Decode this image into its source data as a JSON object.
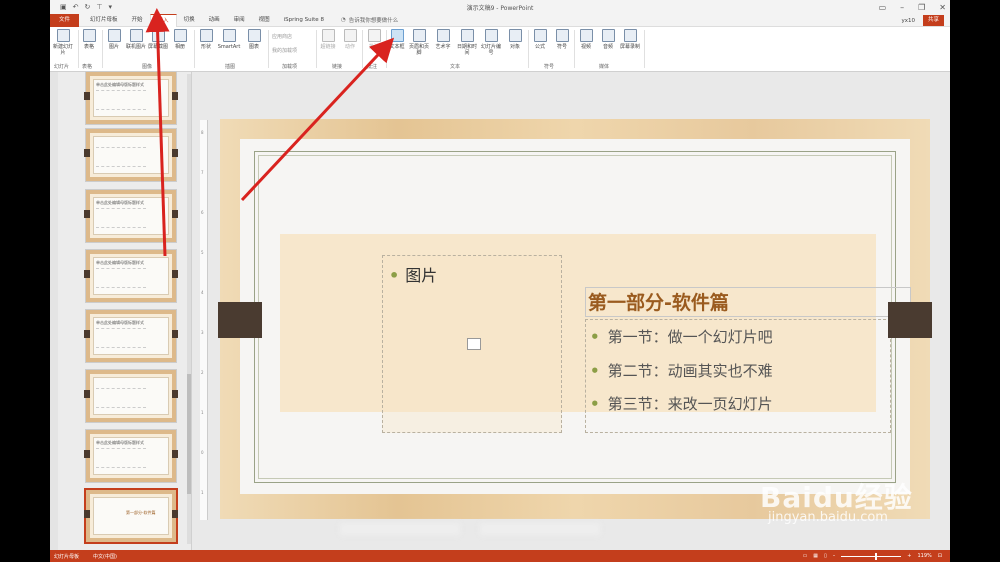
{
  "window": {
    "title": "演示文稿9 - PowerPoint",
    "user": "yx10",
    "share_label": "共享"
  },
  "tabs": [
    {
      "label": "文件"
    },
    {
      "label": "幻灯片母板"
    },
    {
      "label": "开始"
    },
    {
      "label": "插入"
    },
    {
      "label": "切换"
    },
    {
      "label": "动画"
    },
    {
      "label": "审阅"
    },
    {
      "label": "视图"
    },
    {
      "label": "iSpring Suite 8"
    }
  ],
  "tellme": "告诉我你想要做什么",
  "ribbon": {
    "buttons": [
      {
        "label": "新建幻灯片"
      },
      {
        "label": "表格"
      },
      {
        "label": "图片"
      },
      {
        "label": "联机图片"
      },
      {
        "label": "屏幕截图"
      },
      {
        "label": "相册"
      },
      {
        "label": "形状"
      },
      {
        "label": "SmartArt"
      },
      {
        "label": "图表"
      },
      {
        "label": "超链接"
      },
      {
        "label": "动作"
      },
      {
        "label": "批注"
      },
      {
        "label": "文本框"
      },
      {
        "label": "页眉和页脚"
      },
      {
        "label": "艺术字"
      },
      {
        "label": "日期和时间"
      },
      {
        "label": "幻灯片编号"
      },
      {
        "label": "对象"
      },
      {
        "label": "公式"
      },
      {
        "label": "符号"
      },
      {
        "label": "视频"
      },
      {
        "label": "音频"
      },
      {
        "label": "屏幕录制"
      }
    ],
    "small": [
      "应用商店",
      "我的加载项"
    ],
    "groups": [
      "幻灯片",
      "表格",
      "图像",
      "插图",
      "加载项",
      "链接",
      "批注",
      "文本",
      "符号",
      "媒体"
    ]
  },
  "thumbnails": [
    {
      "num": "",
      "title": "单击此处编辑母版标题样式"
    },
    {
      "num": "",
      "title": ""
    },
    {
      "num": "",
      "title": "单击此处编辑母版标题样式"
    },
    {
      "num": "",
      "title": "单击此处编辑母版标题样式"
    },
    {
      "num": "",
      "title": "单击此处编辑母版标题样式"
    },
    {
      "num": "",
      "title": ""
    },
    {
      "num": "",
      "title": "单击此处编辑母版标题样式"
    },
    {
      "num": "",
      "title": "第一部分-软件篇"
    }
  ],
  "slide": {
    "placeholder_bullet": "图片",
    "title": "第一部分-软件篇",
    "items": [
      "第一节：做一个幻灯片吧",
      "第二节：动画其实也不难",
      "第三节：来改一页幻灯片"
    ]
  },
  "statusbar": {
    "view": "幻灯片母板",
    "language": "中文(中国)",
    "zoom": "119%"
  },
  "watermark": {
    "brand": "Baidu经验",
    "url": "jingyan.baidu.com"
  },
  "colors": {
    "accent": "#c43e1c",
    "arrow": "#d9231f",
    "title_text": "#9a5b1f",
    "bullet": "#8c9e46"
  }
}
